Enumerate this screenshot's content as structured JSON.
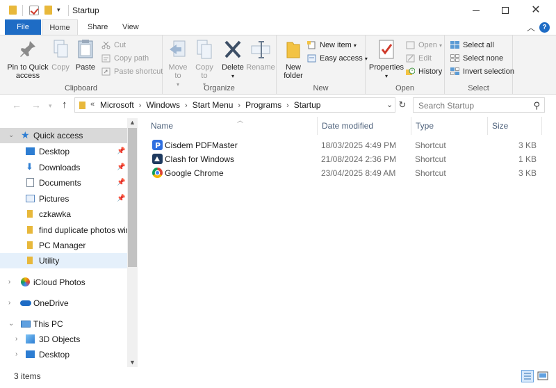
{
  "window": {
    "title": "Startup"
  },
  "ribbon_tabs": {
    "file": "File",
    "home": "Home",
    "share": "Share",
    "view": "View"
  },
  "help_label": "?",
  "ribbon": {
    "clipboard": {
      "label": "Clipboard",
      "pin": "Pin to Quick access",
      "copy": "Copy",
      "paste": "Paste",
      "cut": "Cut",
      "copy_path": "Copy path",
      "paste_shortcut": "Paste shortcut"
    },
    "organize": {
      "label": "Organize",
      "move_to": "Move to",
      "copy_to": "Copy to",
      "delete": "Delete",
      "rename": "Rename"
    },
    "new": {
      "label": "New",
      "new_folder": "New folder",
      "new_item": "New item",
      "easy_access": "Easy access"
    },
    "open": {
      "label": "Open",
      "properties": "Properties",
      "open": "Open",
      "edit": "Edit",
      "history": "History"
    },
    "select": {
      "label": "Select",
      "select_all": "Select all",
      "select_none": "Select none",
      "invert_selection": "Invert selection"
    }
  },
  "address": {
    "overflow": "«",
    "crumbs": [
      "Microsoft",
      "Windows",
      "Start Menu",
      "Programs",
      "Startup"
    ]
  },
  "search": {
    "placeholder": "Search Startup"
  },
  "nav_pane": {
    "quick_access": "Quick access",
    "items": [
      {
        "label": "Desktop",
        "icon": "desktop-icon",
        "pinned": true
      },
      {
        "label": "Downloads",
        "icon": "downloads-icon",
        "pinned": true
      },
      {
        "label": "Documents",
        "icon": "documents-icon",
        "pinned": true
      },
      {
        "label": "Pictures",
        "icon": "pictures-icon",
        "pinned": true
      },
      {
        "label": "czkawka",
        "icon": "folder-icon",
        "pinned": false
      },
      {
        "label": "find duplicate photos win",
        "icon": "folder-icon",
        "pinned": false
      },
      {
        "label": "PC Manager",
        "icon": "folder-icon",
        "pinned": false
      },
      {
        "label": "Utility",
        "icon": "folder-icon",
        "pinned": false
      }
    ],
    "icloud_photos": "iCloud Photos",
    "onedrive": "OneDrive",
    "this_pc": "This PC",
    "this_pc_items": [
      {
        "label": "3D Objects",
        "icon": "3d-objects-icon"
      },
      {
        "label": "Desktop",
        "icon": "desktop-icon"
      }
    ]
  },
  "file_list": {
    "columns": {
      "name": "Name",
      "date_modified": "Date modified",
      "type": "Type",
      "size": "Size"
    },
    "rows": [
      {
        "name": "Cisdem PDFMaster",
        "date": "18/03/2025 4:49 PM",
        "type": "Shortcut",
        "size": "3 KB",
        "icon_color": "#2f6fe0"
      },
      {
        "name": "Clash for Windows",
        "date": "21/08/2024 2:36 PM",
        "type": "Shortcut",
        "size": "1 KB",
        "icon_color": "#1e3a5f"
      },
      {
        "name": "Google Chrome",
        "date": "23/04/2025 8:49 AM",
        "type": "Shortcut",
        "size": "3 KB",
        "icon_color": "#db4437"
      }
    ]
  },
  "status": {
    "item_count": "3 items"
  },
  "colors": {
    "accent": "#1e6cc5",
    "folder": "#e8b83b",
    "selected_bg": "#d9d9d9"
  }
}
